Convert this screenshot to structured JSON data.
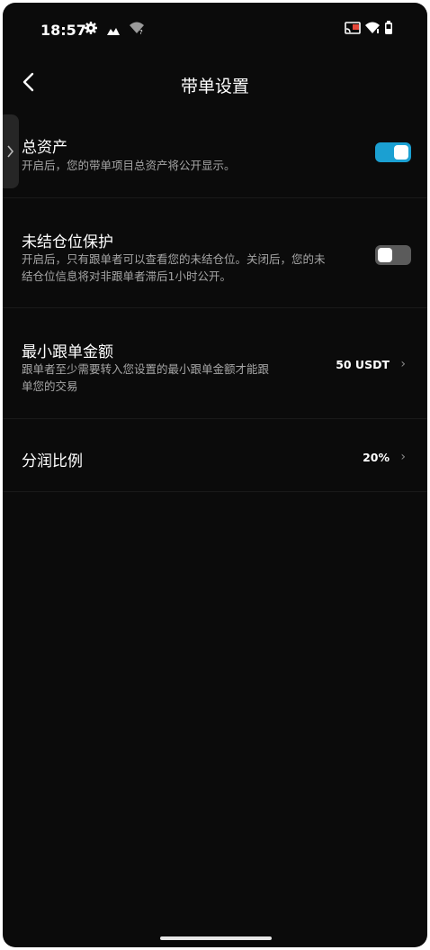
{
  "status_bar": {
    "time": "18:57",
    "icons": [
      "gear-icon",
      "signal-app-icon",
      "wifi-question-icon",
      "cast-icon",
      "wifi-icon",
      "battery-icon"
    ]
  },
  "header": {
    "title": "带单设置"
  },
  "settings": [
    {
      "name": "总资产",
      "desc": "开启后，您的带单项目总资产将公开显示。",
      "toggle": true
    },
    {
      "name": "未结仓位保护",
      "desc_line1": "开启后，只有跟单者可以查看您的未结仓位。关闭后，您的未",
      "desc_line2": "结仓位信息将对非跟单者滞后1小时公开。",
      "toggle": false
    },
    {
      "name": "最小跟单金额",
      "desc_line1": "跟单者至少需要转入您设置的最小跟单金额才能跟",
      "desc_line2": "单您的交易",
      "value": "50 USDT"
    },
    {
      "name": "分润比例",
      "value": "20%"
    }
  ],
  "colors": {
    "accent": "#1ba0d2",
    "background": "#0b0b0b",
    "toggle_off": "#5b5b5b"
  }
}
